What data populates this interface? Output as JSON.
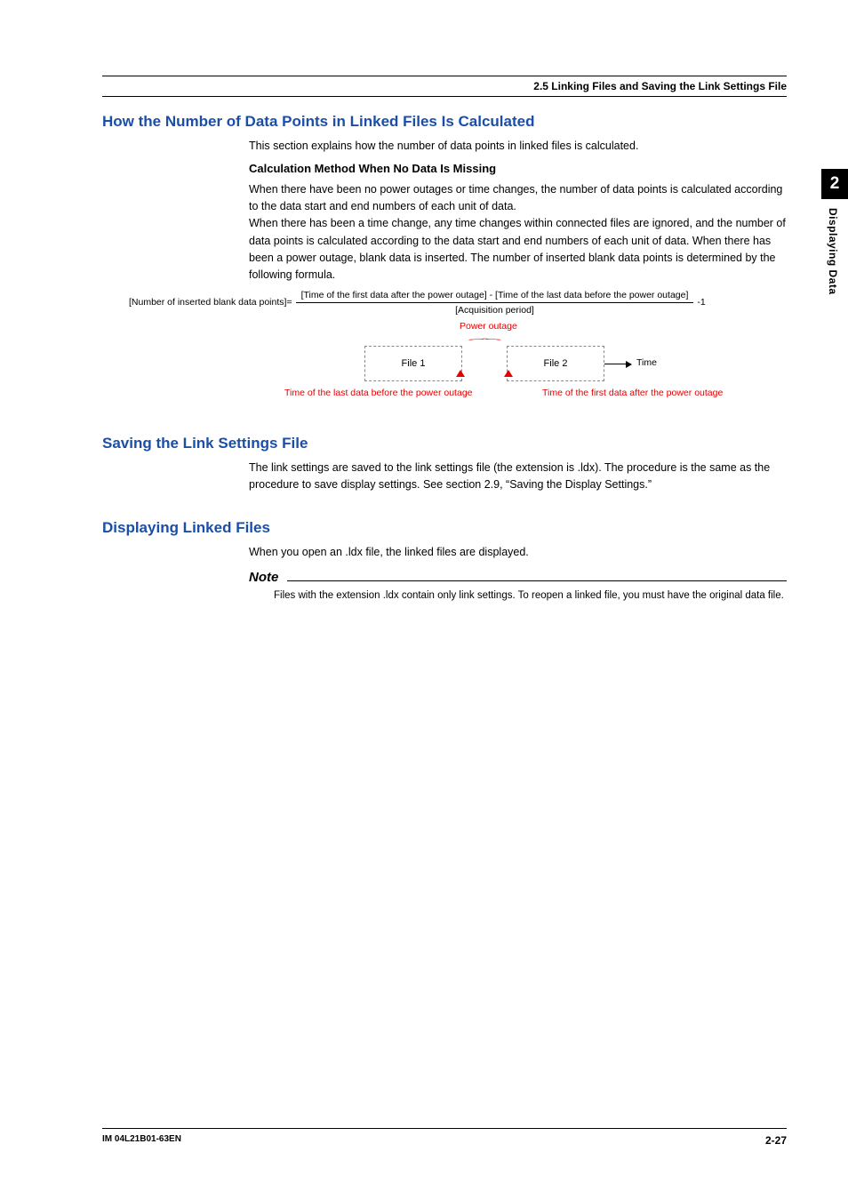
{
  "header": {
    "breadcrumb": "2.5  Linking Files and Saving the Link Settings File"
  },
  "sidetab": {
    "chapter": "2",
    "label": "Displaying Data"
  },
  "s1": {
    "title": "How the Number of Data Points in Linked Files Is Calculated",
    "intro": "This section explains how the number of data points in linked files is calculated.",
    "sub": "Calculation Method When No Data Is Missing",
    "p1": "When there have been no power outages or time changes, the number of data points is calculated according to the data start and end numbers of each unit of data.",
    "p2": "When there has been a time change, any time changes within connected files are ignored, and the number of data points is calculated according to the data start and end numbers of each unit of data. When there has been a power outage, blank data is inserted. The number of inserted blank data points is determined by the following formula.",
    "formula": {
      "lhs": "[Number of inserted blank data points]=",
      "num": "[Time of the first data after the power outage] - [Time of the last data before the power outage]",
      "den": "[Acquisition period]",
      "tail": "-1"
    },
    "diagram": {
      "outage": "Power outage",
      "file1": "File 1",
      "file2": "File 2",
      "time": "Time",
      "before": "Time of the last data before the power outage",
      "after": "Time of the first data after the power outage"
    }
  },
  "s2": {
    "title": "Saving the Link Settings File",
    "body": "The link settings are saved to the link settings file (the extension is .ldx). The procedure is the same as the procedure to save display settings. See section 2.9, “Saving the Display Settings.”"
  },
  "s3": {
    "title": "Displaying Linked Files",
    "body": "When you open an .ldx file, the linked files are displayed.",
    "note_label": "Note",
    "note_body": "Files with the extension .ldx contain only link settings. To reopen a linked file, you must have the original data file."
  },
  "footer": {
    "doc": "IM 04L21B01-63EN",
    "page": "2-27"
  }
}
